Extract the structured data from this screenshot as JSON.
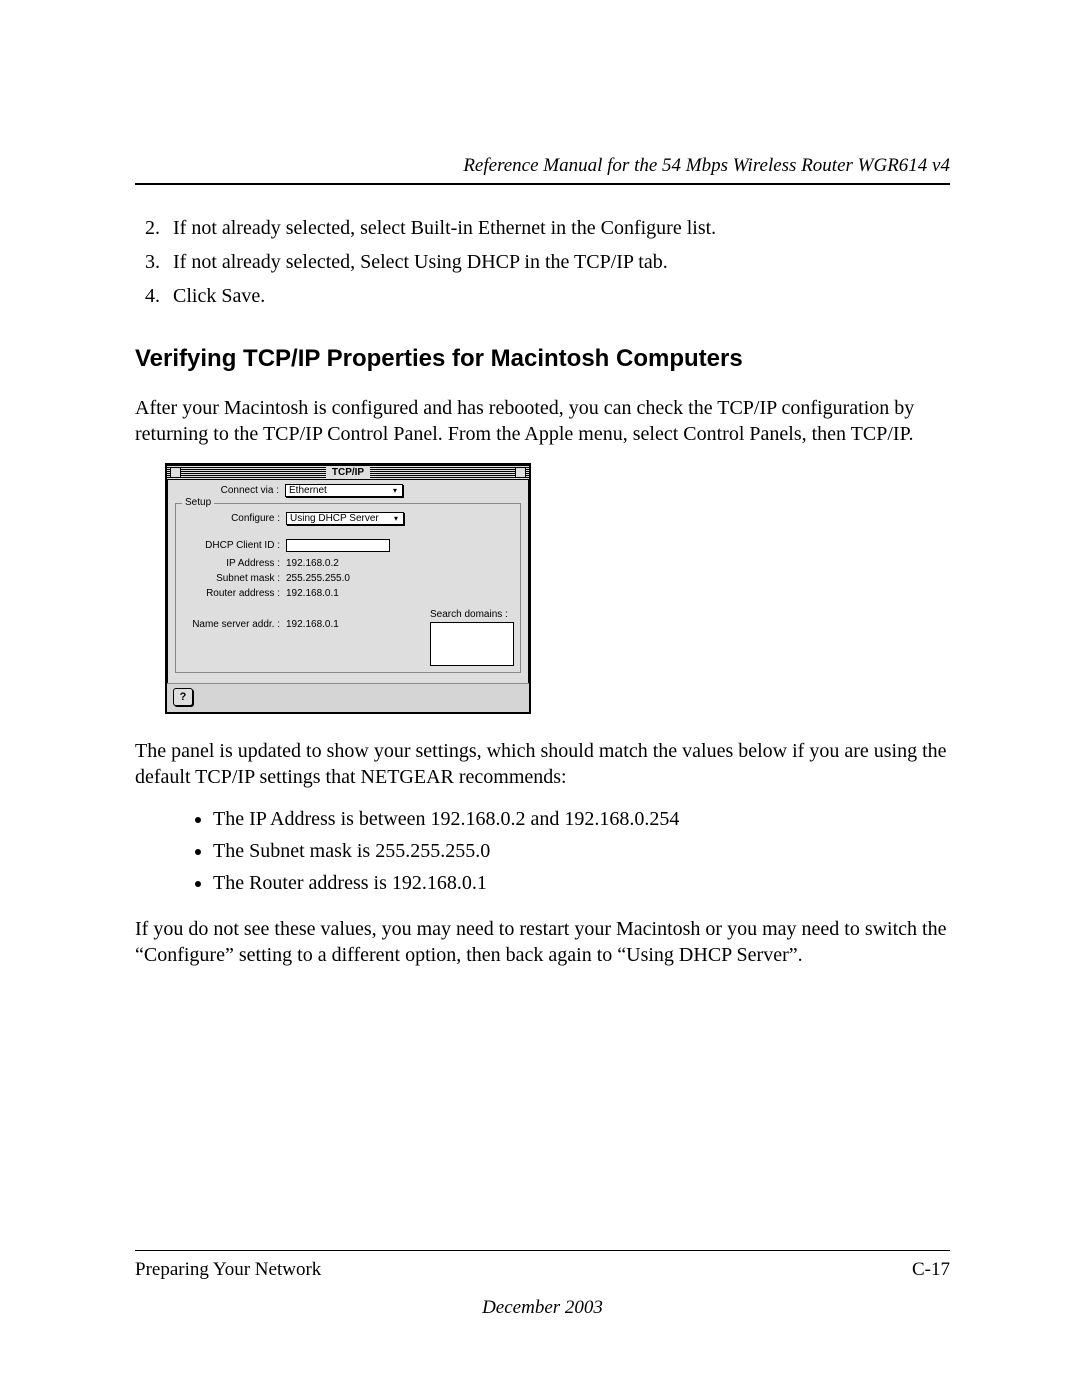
{
  "header": {
    "running_title": "Reference Manual for the 54 Mbps Wireless Router WGR614 v4"
  },
  "steps": {
    "start": 2,
    "items": [
      "If not already selected, select Built-in Ethernet in the Configure list.",
      "If not already selected, Select Using DHCP in the TCP/IP tab.",
      "Click Save."
    ]
  },
  "section_heading": "Verifying TCP/IP Properties for Macintosh Computers",
  "intro_para": "After your Macintosh is configured and has rebooted, you can check the TCP/IP configuration by returning to the TCP/IP Control Panel. From the Apple menu, select Control Panels, then TCP/IP.",
  "panel": {
    "title": "TCP/IP",
    "connect_via_label": "Connect via :",
    "connect_via_value": "Ethernet",
    "setup_legend": "Setup",
    "configure_label": "Configure :",
    "configure_value": "Using DHCP Server",
    "dhcp_client_label": "DHCP Client ID :",
    "dhcp_client_value": "",
    "ip_label": "IP Address :",
    "ip_value": "192.168.0.2",
    "subnet_label": "Subnet mask :",
    "subnet_value": "255.255.255.0",
    "router_label": "Router address :",
    "router_value": "192.168.0.1",
    "nameserver_label": "Name server addr. :",
    "nameserver_value": "192.168.0.1",
    "search_domains_label": "Search domains :",
    "help_glyph": "?"
  },
  "after_panel_para": "The panel is updated to show your settings, which should match the values below if you are using the default TCP/IP settings that NETGEAR recommends:",
  "bullets": [
    "The IP Address is between 192.168.0.2 and 192.168.0.254",
    "The Subnet mask is 255.255.255.0",
    "The Router address is 192.168.0.1"
  ],
  "closing_para": "If you do not see these values, you may need to restart your Macintosh or you may need to switch the “Configure” setting to a different option, then back again to “Using DHCP Server”.",
  "footer": {
    "section": "Preparing Your Network",
    "page": "C-17",
    "date": "December 2003"
  }
}
